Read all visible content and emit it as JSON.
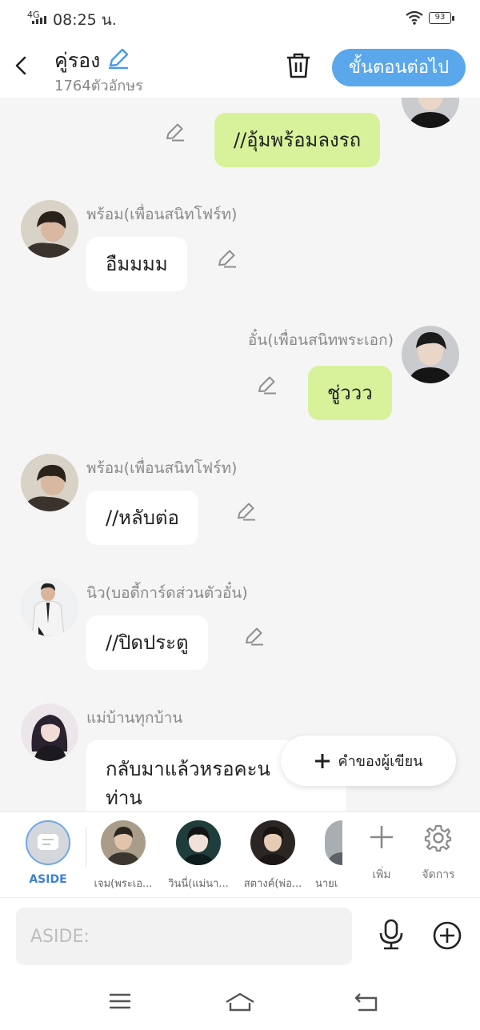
{
  "status_bar": {
    "network": "4G",
    "time": "08:25 น.",
    "battery": "93"
  },
  "header": {
    "title": "คู่รอง",
    "subtitle": "1764ตัวอักษร",
    "next_button": "ขั้นตอนต่อไป"
  },
  "messages": [
    {
      "side": "right",
      "name": "",
      "text": "//อุ้มพร้อมลงรถ"
    },
    {
      "side": "left",
      "name": "พร้อม(เพื่อนสนิทโฟร์ท)",
      "text": "อืมมมม"
    },
    {
      "side": "right",
      "name": "อั๋น(เพื่อนสนิทพระเอก)",
      "text": "ชู่ววว"
    },
    {
      "side": "left",
      "name": "พร้อม(เพื่อนสนิทโฟร์ท)",
      "text": "//หลับต่อ"
    },
    {
      "side": "left",
      "name": "นิว(บอดี้การ์ดส่วนตัวอั๋น)",
      "text": "//ปิดประตู"
    },
    {
      "side": "left",
      "name": "แม่บ้านทุกบ้าน",
      "text": "กลับมาแล้วหรอคะนายท่าน",
      "text_line1": "กลับมาแล้วหรอคะน",
      "text_line2": "ท่าน"
    }
  ],
  "fab": {
    "label": "คำของผู้เขียน"
  },
  "character_bar": {
    "aside_label": "ASIDE",
    "characters": [
      {
        "name": "เจม(พระเอ..."
      },
      {
        "name": "วินนี่(แม่นา..."
      },
      {
        "name": "สตางค์(พ่อ..."
      },
      {
        "name": "นายเ"
      }
    ],
    "add_label": "เพิ่ม",
    "manage_label": "จัดการ"
  },
  "input": {
    "placeholder": "ASIDE:",
    "value": ""
  },
  "colors": {
    "accent": "#5aa7ec",
    "bubble_right": "#d7f29a",
    "bubble_left": "#ffffff",
    "aside_active": "#3b82d6"
  }
}
